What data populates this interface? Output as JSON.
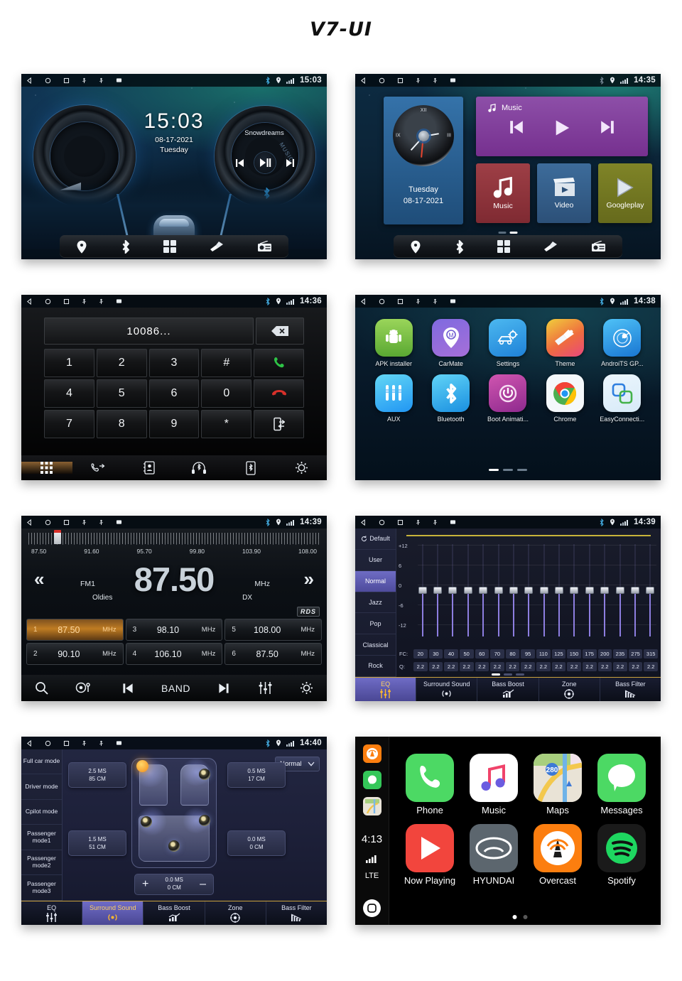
{
  "page": {
    "title": "V7-UI"
  },
  "statusbar": {
    "nav_icons": [
      "back-triangle-icon",
      "home-circle-icon",
      "recents-square-icon",
      "usb-icon",
      "usb-icon",
      "sdcard-icon"
    ],
    "right_icons": [
      "bluetooth-icon",
      "location-pin-icon",
      "signal-bars-icon"
    ]
  },
  "panels": {
    "home_clock": {
      "time": "15:03",
      "clock_big": "15:03",
      "date": "08-17-2021",
      "weekday": "Tuesday",
      "track": "Snowdreams",
      "music_word": "MUSIC",
      "dock": [
        {
          "label": "navigation",
          "icon": "location-pin-icon"
        },
        {
          "label": "bluetooth",
          "icon": "bluetooth-icon"
        },
        {
          "label": "apps",
          "icon": "apps-grid-icon"
        },
        {
          "label": "theme",
          "icon": "paintbrush-icon"
        },
        {
          "label": "radio",
          "icon": "radio-icon"
        }
      ]
    },
    "home_widgets": {
      "time": "14:35",
      "weekday": "Tuesday",
      "date": "08-17-2021",
      "clock_numerals": {
        "twelve": "XII",
        "three": "III",
        "nine": "IX"
      },
      "music_widget_label": "Music",
      "tiles": [
        {
          "label": "Music",
          "icon": "music-note-icon"
        },
        {
          "label": "Video",
          "icon": "video-clapper-icon"
        },
        {
          "label": "Googleplay",
          "icon": "play-triangle-icon"
        }
      ],
      "dock": [
        {
          "label": "navigation",
          "icon": "location-pin-icon"
        },
        {
          "label": "bluetooth",
          "icon": "bluetooth-icon"
        },
        {
          "label": "apps",
          "icon": "apps-grid-icon"
        },
        {
          "label": "theme",
          "icon": "paintbrush-icon"
        },
        {
          "label": "radio",
          "icon": "radio-icon"
        }
      ]
    },
    "dialer": {
      "time": "14:36",
      "number": "10086...",
      "keys": [
        "1",
        "2",
        "3",
        "#",
        "call",
        "4",
        "5",
        "6",
        "0",
        "hangup",
        "7",
        "8",
        "9",
        "*",
        "transfer"
      ],
      "tabs": [
        {
          "name": "keypad",
          "icon": "keypad-grid-icon",
          "selected": true
        },
        {
          "name": "call-log",
          "icon": "call-log-icon",
          "selected": false
        },
        {
          "name": "contacts",
          "icon": "contacts-icon",
          "selected": false
        },
        {
          "name": "bt-audio",
          "icon": "headset-bluetooth-icon",
          "selected": false
        },
        {
          "name": "phone-sync",
          "icon": "phone-bluetooth-icon",
          "selected": false
        },
        {
          "name": "settings",
          "icon": "gear-bluetooth-icon",
          "selected": false
        }
      ]
    },
    "apps": {
      "time": "14:38",
      "items": [
        {
          "label": "APK installer",
          "icon": "android-icon",
          "color": "#79c142"
        },
        {
          "label": "CarMate",
          "icon": "carmate-pin-icon",
          "color": "#8b5cf6"
        },
        {
          "label": "Settings",
          "icon": "car-gear-icon",
          "color": "#2196f3"
        },
        {
          "label": "Theme",
          "icon": "paintbrush-icon",
          "color": "#f26d4f"
        },
        {
          "label": "AndroiTS GP...",
          "icon": "gps-radar-icon",
          "color": "#2f9fe0"
        },
        {
          "label": "AUX",
          "icon": "aux-jacks-icon",
          "color": "#3fc0f0"
        },
        {
          "label": "Bluetooth",
          "icon": "bluetooth-icon",
          "color": "#35a7e8"
        },
        {
          "label": "Boot Animati...",
          "icon": "power-icon",
          "color": "#c0379a"
        },
        {
          "label": "Chrome",
          "icon": "chrome-icon",
          "color": "#ffffff"
        },
        {
          "label": "EasyConnecti...",
          "icon": "easyconnect-icon",
          "color": "#eaf4fb"
        }
      ],
      "page_dots": 3,
      "active_page": 1
    },
    "radio": {
      "time": "14:39",
      "frequency": "87.50",
      "unit": "MHz",
      "band": "FM1",
      "genre": "Oldies",
      "sensitivity": "DX",
      "rds": "RDS",
      "scale_labels": [
        "87.50",
        "91.60",
        "95.70",
        "99.80",
        "103.90",
        "108.00"
      ],
      "presets": [
        {
          "no": "1",
          "freq": "87.50",
          "unit": "MHz",
          "selected": true
        },
        {
          "no": "2",
          "freq": "90.10",
          "unit": "MHz",
          "selected": false
        },
        {
          "no": "3",
          "freq": "98.10",
          "unit": "MHz",
          "selected": false
        },
        {
          "no": "4",
          "freq": "106.10",
          "unit": "MHz",
          "selected": false
        },
        {
          "no": "5",
          "freq": "108.00",
          "unit": "MHz",
          "selected": false
        },
        {
          "no": "6",
          "freq": "87.50",
          "unit": "MHz",
          "selected": false
        }
      ],
      "toolbar": [
        {
          "name": "search",
          "icon": "magnifier-icon",
          "label": ""
        },
        {
          "name": "scan",
          "icon": "antenna-icon",
          "label": ""
        },
        {
          "name": "prev",
          "icon": "prev-track-icon",
          "label": ""
        },
        {
          "name": "band",
          "icon": "",
          "label": "BAND"
        },
        {
          "name": "next",
          "icon": "next-track-icon",
          "label": ""
        },
        {
          "name": "equalizer",
          "icon": "sliders-icon",
          "label": ""
        },
        {
          "name": "settings",
          "icon": "gear-icon",
          "label": ""
        }
      ]
    },
    "equalizer": {
      "time": "14:39",
      "presets": [
        {
          "label": "Default",
          "icon": "refresh-icon",
          "selected": false
        },
        {
          "label": "User",
          "icon": "",
          "selected": false
        },
        {
          "label": "Normal",
          "icon": "",
          "selected": true
        },
        {
          "label": "Jazz",
          "icon": "",
          "selected": false
        },
        {
          "label": "Pop",
          "icon": "",
          "selected": false
        },
        {
          "label": "Classical",
          "icon": "",
          "selected": false
        },
        {
          "label": "Rock",
          "icon": "",
          "selected": false
        }
      ],
      "y_labels": [
        "+12",
        "6",
        "0",
        "-6",
        "-12"
      ],
      "fc_label": "FC:",
      "q_label": "Q:",
      "fc_values": [
        "20",
        "30",
        "40",
        "50",
        "60",
        "70",
        "80",
        "95",
        "110",
        "125",
        "150",
        "175",
        "200",
        "235",
        "275",
        "315"
      ],
      "q_values": [
        "2.2",
        "2.2",
        "2.2",
        "2.2",
        "2.2",
        "2.2",
        "2.2",
        "2.2",
        "2.2",
        "2.2",
        "2.2",
        "2.2",
        "2.2",
        "2.2",
        "2.2",
        "2.2"
      ],
      "band_gains": [
        0,
        0,
        0,
        0,
        0,
        0,
        0,
        0,
        0,
        0,
        0,
        0,
        0,
        0,
        0,
        0
      ],
      "page_dots": 3,
      "active_page": 1,
      "tabs": [
        {
          "label": "EQ",
          "icon": "sliders-icon",
          "selected": true
        },
        {
          "label": "Surround Sound",
          "icon": "surround-icon",
          "selected": false
        },
        {
          "label": "Bass Boost",
          "icon": "bass-chart-icon",
          "selected": false
        },
        {
          "label": "Zone",
          "icon": "target-icon",
          "selected": false
        },
        {
          "label": "Bass Filter",
          "icon": "bars-icon",
          "selected": false
        }
      ]
    },
    "surround": {
      "time": "14:40",
      "modes": [
        {
          "label": "Full car mode"
        },
        {
          "label": "Driver mode"
        },
        {
          "label": "Cpilot mode"
        },
        {
          "label": "Passenger mode1"
        },
        {
          "label": "Passenger mode2"
        },
        {
          "label": "Passenger mode3"
        }
      ],
      "profile": "Normal",
      "delays": {
        "front_left": {
          "ms": "2.5 MS",
          "cm": "85 CM"
        },
        "front_right": {
          "ms": "0.5 MS",
          "cm": "17 CM"
        },
        "rear_left": {
          "ms": "1.5 MS",
          "cm": "51 CM"
        },
        "rear_right": {
          "ms": "0.0 MS",
          "cm": "0 CM"
        },
        "center": {
          "ms": "0.0 MS",
          "cm": "0 CM"
        }
      },
      "stepper": {
        "plus": "+",
        "minus": "–"
      },
      "tabs": [
        {
          "label": "EQ",
          "icon": "sliders-icon",
          "selected": false
        },
        {
          "label": "Surround Sound",
          "icon": "surround-icon",
          "selected": true
        },
        {
          "label": "Bass Boost",
          "icon": "bass-chart-icon",
          "selected": false
        },
        {
          "label": "Zone",
          "icon": "target-icon",
          "selected": false
        },
        {
          "label": "Bass Filter",
          "icon": "bars-icon",
          "selected": false
        }
      ]
    },
    "carplay": {
      "time": "4:13",
      "network": "LTE",
      "rail_icons": [
        "overcast-icon",
        "messages-icon",
        "maps-icon"
      ],
      "apps": [
        {
          "label": "Phone",
          "icon": "phone-handset-icon"
        },
        {
          "label": "Music",
          "icon": "apple-music-icon"
        },
        {
          "label": "Maps",
          "icon": "apple-maps-icon",
          "badge": "280"
        },
        {
          "label": "Messages",
          "icon": "messages-bubble-icon"
        },
        {
          "label": "Now Playing",
          "icon": "now-playing-icon"
        },
        {
          "label": "HYUNDAI",
          "icon": "hyundai-logo-icon"
        },
        {
          "label": "Overcast",
          "icon": "overcast-icon"
        },
        {
          "label": "Spotify",
          "icon": "spotify-icon"
        }
      ],
      "page_dots": 2,
      "active_page": 1
    }
  }
}
